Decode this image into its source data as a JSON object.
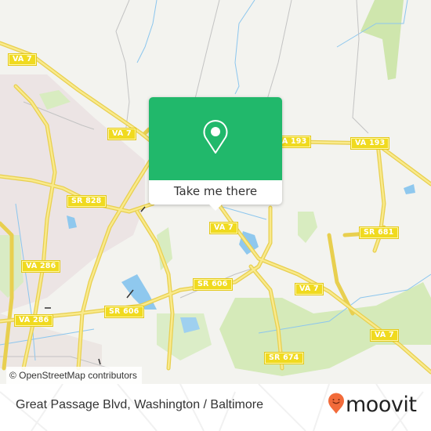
{
  "map": {
    "colors": {
      "land": "#f3f3ef",
      "urban": "#ebe3e3",
      "park": "#cfe8b0",
      "water": "#8fc8ee",
      "road_major": "#f7e16a",
      "road_minor": "#bdbdbd"
    },
    "road_labels": [
      {
        "id": "va7-nw",
        "text": "VA 7"
      },
      {
        "id": "va7-center-left",
        "text": "VA 7"
      },
      {
        "id": "va193-a",
        "text": "VA 193"
      },
      {
        "id": "va193-b",
        "text": "VA 193"
      },
      {
        "id": "sr828",
        "text": "SR 828"
      },
      {
        "id": "va7-center",
        "text": "VA 7"
      },
      {
        "id": "sr681",
        "text": "SR 681"
      },
      {
        "id": "va286-a",
        "text": "VA 286"
      },
      {
        "id": "sr606-a",
        "text": "SR 606"
      },
      {
        "id": "va7-east",
        "text": "VA 7"
      },
      {
        "id": "sr606-b",
        "text": "SR 606"
      },
      {
        "id": "va286-b",
        "text": "VA 286"
      },
      {
        "id": "va7-se",
        "text": "VA 7"
      },
      {
        "id": "sr674",
        "text": "SR 674"
      }
    ],
    "attribution": "© OpenStreetMap contributors"
  },
  "popup": {
    "icon": "location-pin-icon",
    "button_label": "Take me there",
    "color": "#21b86b"
  },
  "footer": {
    "address": "Great Passage Blvd, Washington / Baltimore",
    "brand": "moovit",
    "brand_icon": "moovit-pin-logo-icon",
    "brand_color": "#f26b3a"
  }
}
